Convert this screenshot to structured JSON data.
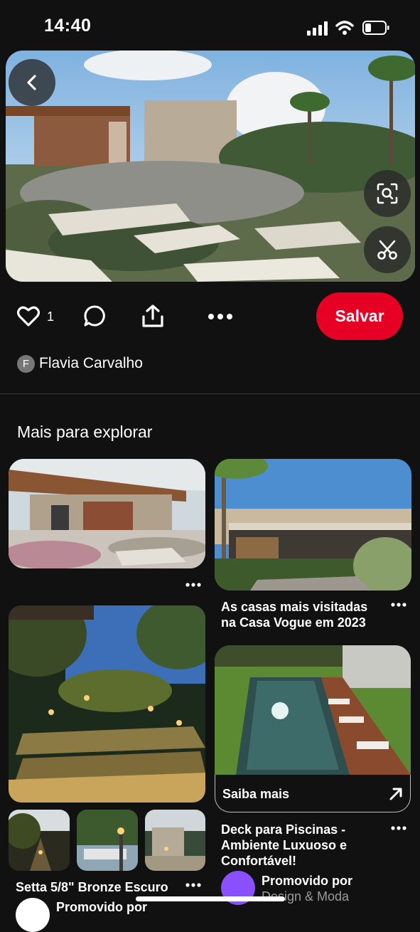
{
  "status_bar": {
    "time": "14:40"
  },
  "pin": {
    "likes": "1",
    "save_label": "Salvar",
    "author_initial": "F",
    "author": "Flavia Carvalho"
  },
  "explore": {
    "title": "Mais para explorar",
    "cards": [
      {
        "caption": ""
      },
      {
        "caption_line1": "As casas mais visitadas",
        "caption_line2": "na Casa Vogue em 2023"
      },
      {
        "caption": "Setta 5/8\" Bronze Escuro",
        "promo": "Promovido por"
      },
      {
        "cta": "Saiba mais",
        "caption_line1": "Deck para Piscinas -",
        "caption_line2": "Ambiente Luxuoso e",
        "caption_line3": "Confortável!",
        "promo": "Promovido por",
        "promoter": "Design & Moda"
      }
    ]
  },
  "colors": {
    "accent": "#e60023",
    "background": "#111111"
  },
  "icons": [
    "back-icon",
    "visual-search-icon",
    "scissors-icon",
    "heart-icon",
    "comment-icon",
    "share-icon",
    "more-icon",
    "arrow-up-right-icon"
  ]
}
